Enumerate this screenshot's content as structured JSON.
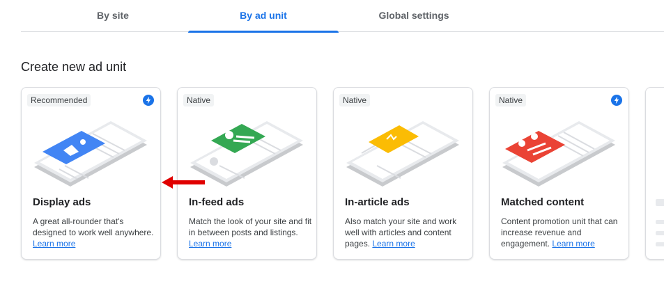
{
  "tabs": [
    {
      "label": "By site"
    },
    {
      "label": "By ad unit"
    },
    {
      "label": "Global settings"
    }
  ],
  "active_tab": "By ad unit",
  "heading": "Create new ad unit",
  "cards": [
    {
      "badge": "Recommended",
      "icon": "lightning-bolt-icon",
      "title": "Display ads",
      "description": "A great all-rounder that's designed to work well anywhere.",
      "learn_more": "Learn more",
      "accent": "#4285f4"
    },
    {
      "badge": "Native",
      "title": "In-feed ads",
      "description": "Match the look of your site and fit in between posts and listings.",
      "learn_more": "Learn more",
      "accent": "#34a853"
    },
    {
      "badge": "Native",
      "title": "In-article ads",
      "description": "Also match your site and work well with articles and content pages.",
      "learn_more": "Learn more",
      "accent": "#fbbc04"
    },
    {
      "badge": "Native",
      "icon": "lightning-bolt-icon",
      "title": "Matched content",
      "description": "Content promotion unit that can increase revenue and engagement.",
      "learn_more": "Learn more",
      "accent": "#ea4335"
    }
  ],
  "colors": {
    "primary": "#1a73e8",
    "annotation_arrow": "#e00000"
  }
}
